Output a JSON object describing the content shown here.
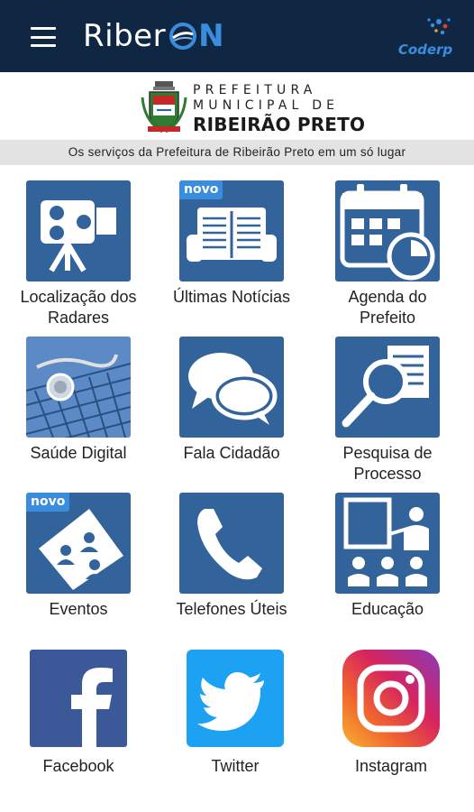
{
  "appbar": {
    "logo_prefix": "Riber",
    "logo_suffix": "N",
    "partner_logo": "Coderp",
    "menu_icon": "hamburger-menu-icon",
    "background": "#0f2742"
  },
  "header": {
    "line1": "PREFEITURA",
    "line2": "MUNICIPAL DE",
    "line3": "RIBEIRÃO PRETO",
    "tagline": "Os serviços da Prefeitura de Ribeirão Preto em um só lugar"
  },
  "tiles": [
    {
      "label": "Localização dos Radares",
      "icon": "speed-camera-icon"
    },
    {
      "label": "Últimas Notícias",
      "icon": "newspaper-icon",
      "badge": "novo"
    },
    {
      "label": "Agenda do Prefeito",
      "icon": "calendar-clock-icon"
    },
    {
      "label": "Saúde Digital",
      "icon": "stethoscope-keyboard-icon"
    },
    {
      "label": "Fala Cidadão",
      "icon": "speech-bubbles-icon"
    },
    {
      "label": "Pesquisa de Processo",
      "icon": "document-search-icon"
    },
    {
      "label": "Eventos",
      "icon": "ticket-people-icon",
      "badge": "novo"
    },
    {
      "label": "Telefones Úteis",
      "icon": "phone-icon"
    },
    {
      "label": "Educação",
      "icon": "classroom-icon"
    },
    {
      "label": "Facebook",
      "icon": "facebook-icon"
    },
    {
      "label": "Twitter",
      "icon": "twitter-icon"
    },
    {
      "label": "Instagram",
      "icon": "instagram-icon"
    }
  ],
  "colors": {
    "tile_blue": "#33639b",
    "badge_blue": "#3a8dde",
    "facebook": "#3b5998",
    "twitter": "#1da1f2"
  }
}
